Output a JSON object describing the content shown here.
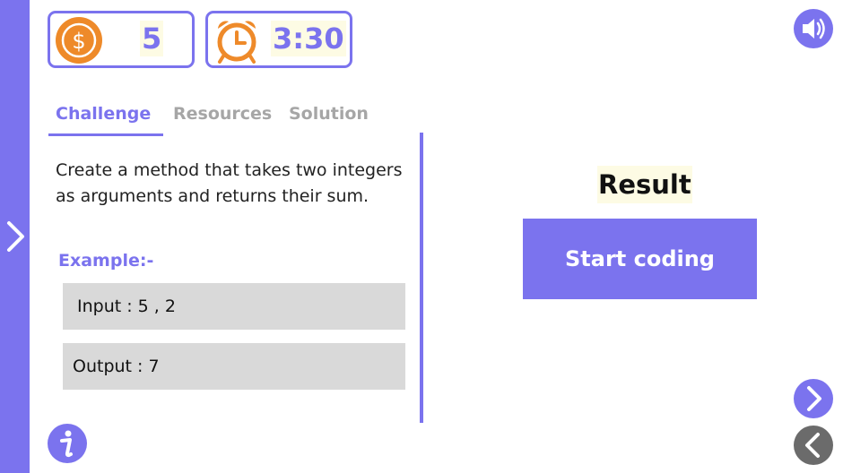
{
  "stats": {
    "coins": {
      "icon": "dollar-coin-icon",
      "value": "5"
    },
    "timer": {
      "icon": "alarm-clock-icon",
      "value": "3:30"
    }
  },
  "tabs": [
    {
      "label": "Challenge",
      "active": true
    },
    {
      "label": "Resources",
      "active": false
    },
    {
      "label": "Solution",
      "active": false
    }
  ],
  "challenge": {
    "description": "Create a method that takes two integers as arguments and returns their sum.",
    "example_label": "Example:-",
    "input": "Input : 5 , 2",
    "output": "Output : 7"
  },
  "result": {
    "title": "Result",
    "start_label": "Start coding"
  },
  "icons": {
    "sidebar_toggle": "chevron-right-icon",
    "sound": "speaker-icon",
    "info": "info-icon",
    "next": "chevron-right-icon",
    "prev": "chevron-left-icon"
  },
  "colors": {
    "accent": "#7b73ee",
    "coin": "#ee8a2a",
    "highlight": "#fdfbe4",
    "inactive_tab": "#a6a6a6",
    "example_box": "#d9d9d9",
    "prev_button": "#6b6b6b"
  }
}
